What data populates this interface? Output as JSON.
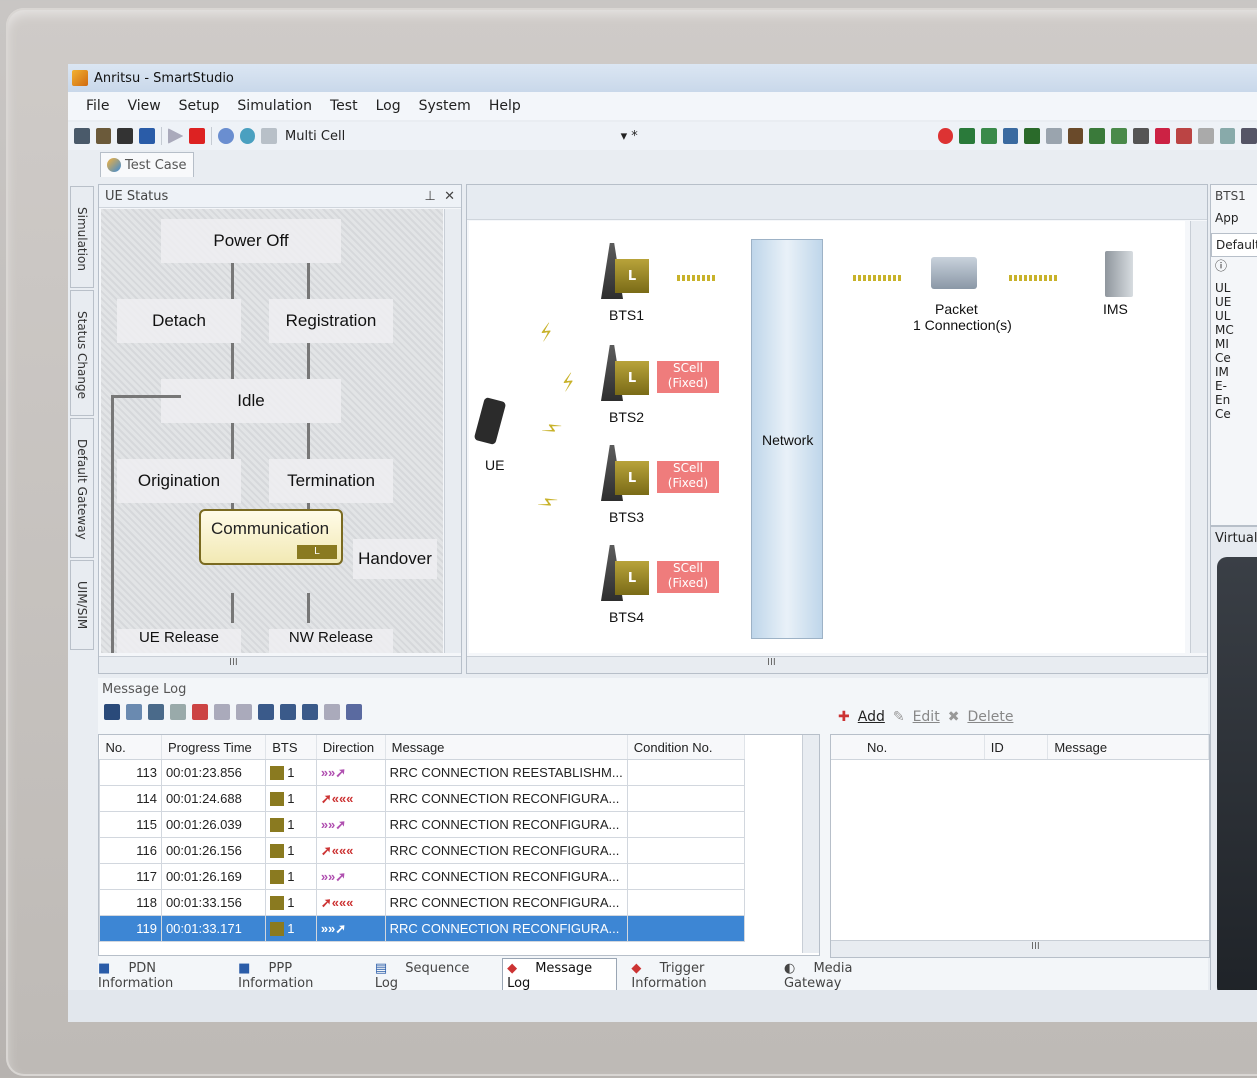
{
  "window": {
    "title": "Anritsu - SmartStudio"
  },
  "menu": [
    "File",
    "View",
    "Setup",
    "Simulation",
    "Test",
    "Log",
    "System",
    "Help"
  ],
  "toolbar": {
    "cell_mode": "Multi Cell",
    "cell_value": "*"
  },
  "doc_tab": "Test Case",
  "side_tabs": [
    "Simulation",
    "Status Change",
    "Default Gateway",
    "UIM/SIM"
  ],
  "ue_status": {
    "title": "UE Status",
    "states": [
      "Power Off",
      "Detach",
      "Registration",
      "Idle",
      "Origination",
      "Termination",
      "Communication",
      "Handover",
      "UE Release",
      "NW Release"
    ],
    "scroll_marker": "III"
  },
  "network": {
    "ue_label": "UE",
    "bts": [
      "BTS1",
      "BTS2",
      "BTS3",
      "BTS4"
    ],
    "lte_badge": "L",
    "scell_label": "SCell (Fixed)",
    "network_label": "Network",
    "packet_label": "Packet",
    "connections_label": "1 Connection(s)",
    "ims_label": "IMS",
    "scroll_marker": "III"
  },
  "right_panel": {
    "title": "BTS1",
    "app_label": "App",
    "default_label": "Default",
    "items": [
      "UL",
      "UE",
      "UL",
      "MC",
      "MI",
      "Ce",
      "IM",
      "E-",
      "En",
      "Ce"
    ]
  },
  "virtual_panel": {
    "title": "Virtual"
  },
  "message_log": {
    "title": "Message Log",
    "columns": [
      "No.",
      "Progress Time",
      "BTS",
      "Direction",
      "Message",
      "Condition No."
    ],
    "rows": [
      {
        "no": "113",
        "time": "00:01:23.856",
        "bts": "1",
        "dir": "up",
        "msg": "RRC CONNECTION REESTABLISHM..."
      },
      {
        "no": "114",
        "time": "00:01:24.688",
        "bts": "1",
        "dir": "down",
        "msg": "RRC CONNECTION RECONFIGURA..."
      },
      {
        "no": "115",
        "time": "00:01:26.039",
        "bts": "1",
        "dir": "up",
        "msg": "RRC CONNECTION RECONFIGURA..."
      },
      {
        "no": "116",
        "time": "00:01:26.156",
        "bts": "1",
        "dir": "down",
        "msg": "RRC CONNECTION RECONFIGURA..."
      },
      {
        "no": "117",
        "time": "00:01:26.169",
        "bts": "1",
        "dir": "up",
        "msg": "RRC CONNECTION RECONFIGURA..."
      },
      {
        "no": "118",
        "time": "00:01:33.156",
        "bts": "1",
        "dir": "down",
        "msg": "RRC CONNECTION RECONFIGURA..."
      },
      {
        "no": "119",
        "time": "00:01:33.171",
        "bts": "1",
        "dir": "up",
        "msg": "RRC CONNECTION RECONFIGURA..."
      }
    ],
    "selected_row": "119"
  },
  "trigger_panel": {
    "add": "Add",
    "edit": "Edit",
    "delete": "Delete",
    "columns": [
      "No.",
      "ID",
      "Message"
    ],
    "scroll_marker": "III"
  },
  "bottom_tabs": [
    "PDN Information",
    "PPP Information",
    "Sequence Log",
    "Message Log",
    "Trigger Information",
    "Media Gateway"
  ],
  "active_bottom_tab": "Message Log",
  "colors": {
    "accent": "#3d86d4",
    "lte_badge": "#8a7a20",
    "scell": "#ef7c7c"
  }
}
